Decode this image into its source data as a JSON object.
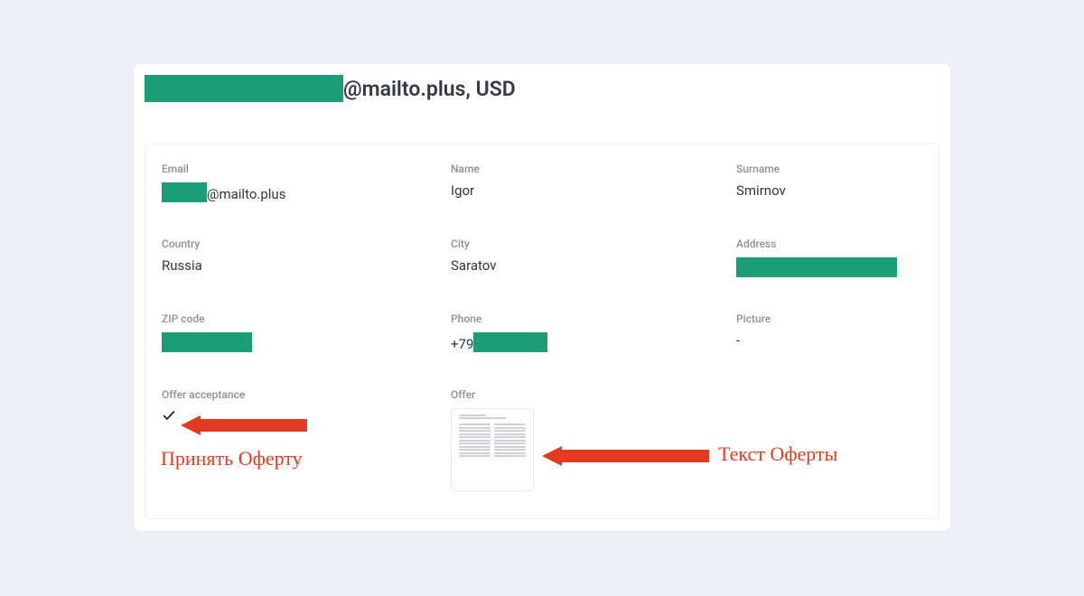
{
  "header": {
    "title_suffix": "@mailto.plus, USD"
  },
  "labels": {
    "email": "Email",
    "name": "Name",
    "surname": "Surname",
    "country": "Country",
    "city": "City",
    "address": "Address",
    "zip": "ZIP code",
    "phone": "Phone",
    "picture": "Picture",
    "offer_acceptance": "Offer acceptance",
    "offer": "Offer"
  },
  "values": {
    "email_suffix": "@mailto.plus",
    "name": "Igor",
    "surname": "Smirnov",
    "country": "Russia",
    "city": "Saratov",
    "phone_prefix": "+79",
    "picture": "-"
  },
  "annotations": {
    "accept": "Принять Оферту",
    "offer_text": "Текст Оферты"
  }
}
